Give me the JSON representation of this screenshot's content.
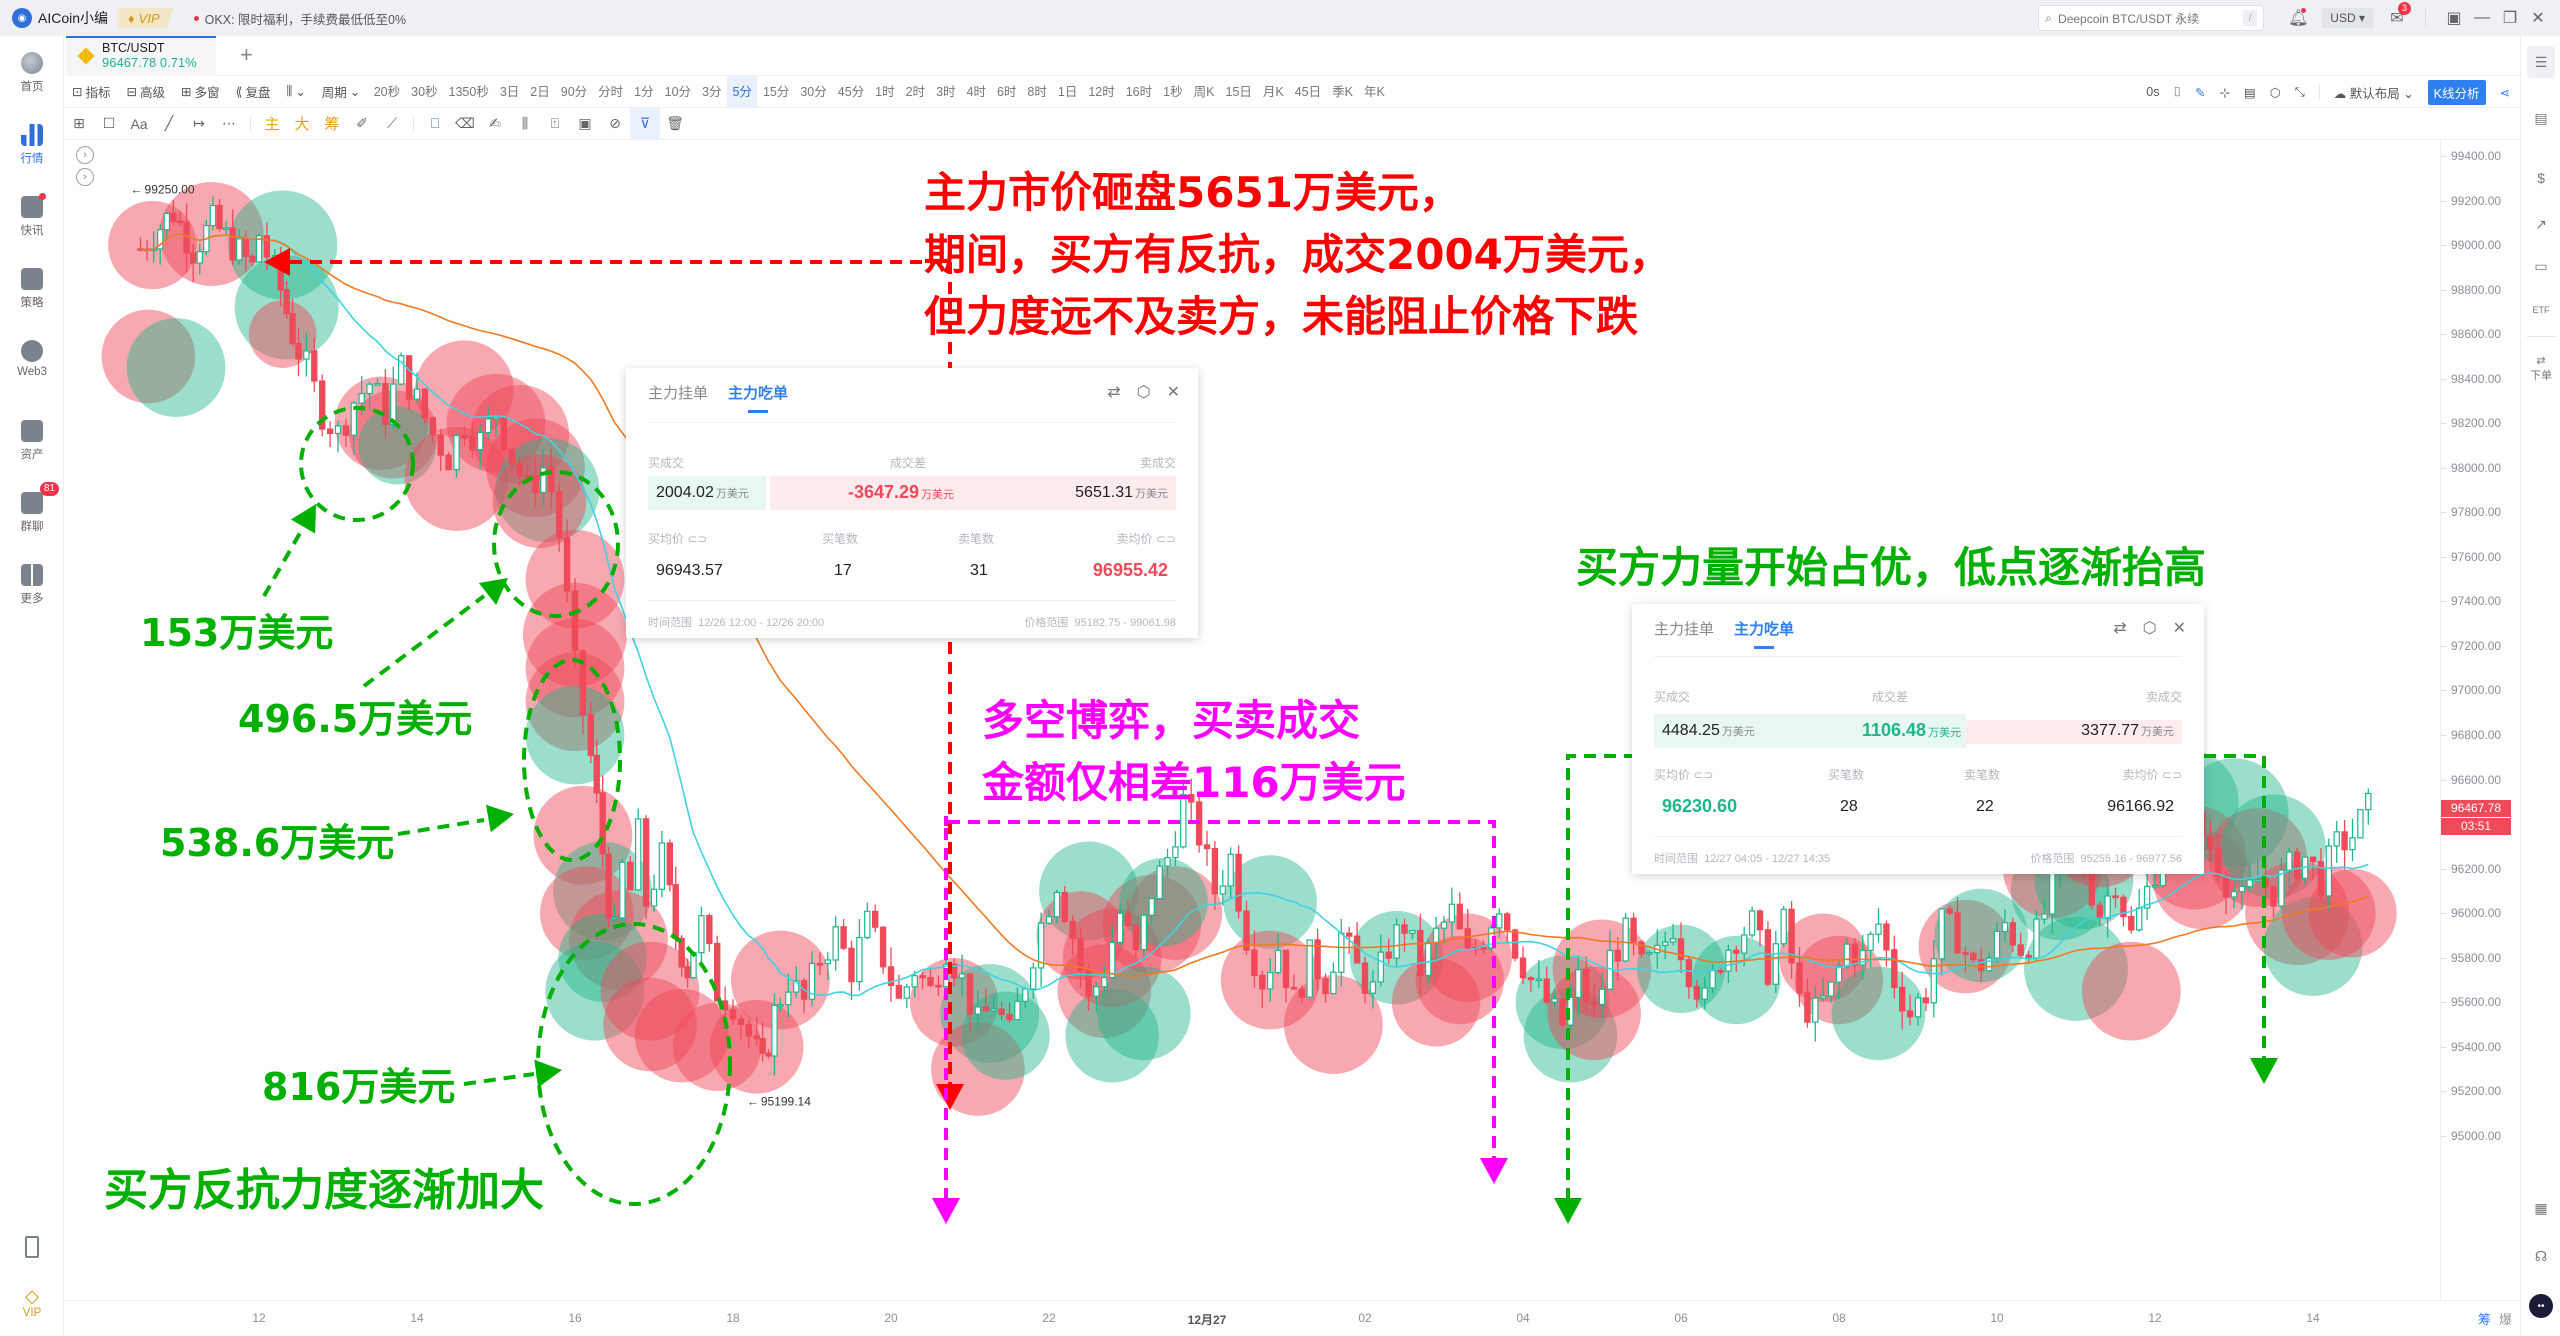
{
  "titlebar": {
    "app_name": "AICoin小编",
    "vip_label": "VIP",
    "promo": "OKX: 限时福利，手续费最低低至0%",
    "search_placeholder": "Deepcoin BTC/USDT 永续",
    "search_shortcut": "/",
    "currency": "USD",
    "mail_badge": "3"
  },
  "left_sidebar": {
    "items": [
      {
        "label": "首页",
        "icon": "home-globe-icon"
      },
      {
        "label": "行情",
        "icon": "market-bars-icon",
        "active": true
      },
      {
        "label": "快讯",
        "icon": "news-icon",
        "dot": true
      },
      {
        "label": "策略",
        "icon": "robot-strategy-icon"
      },
      {
        "label": "Web3",
        "icon": "web3-icon"
      },
      {
        "label": "资产",
        "icon": "wallet-icon"
      },
      {
        "label": "群聊",
        "icon": "chat-icon",
        "badge": "81"
      },
      {
        "label": "更多",
        "icon": "more-grid-icon"
      }
    ],
    "bottom": [
      {
        "label": "",
        "icon": "mobile-icon"
      },
      {
        "label": "VIP",
        "icon": "vip-diamond-icon"
      }
    ]
  },
  "symbol_tab": {
    "pair": "BTC/USDT",
    "price": "96467.78",
    "change": "0.71%"
  },
  "toolbar": {
    "tools": [
      "指标",
      "高级",
      "多窗",
      "复盘",
      "",
      "周期"
    ],
    "periods": [
      "20秒",
      "30秒",
      "1350秒",
      "3日",
      "2日",
      "90分",
      "分时",
      "1分",
      "10分",
      "3分",
      "5分",
      "15分",
      "30分",
      "45分",
      "1时",
      "2时",
      "3时",
      "4时",
      "6时",
      "8时",
      "1日",
      "12时",
      "16时",
      "1秒",
      "周K",
      "15日",
      "月K",
      "45日",
      "季K",
      "年K"
    ],
    "selected_period": "5分",
    "right_timer": "0s",
    "layout_label": "默认布局",
    "kline_analysis": "K线分析"
  },
  "drawing_toolbar": {
    "gold_labels": [
      "主",
      "大",
      "筹"
    ]
  },
  "chart": {
    "y_ticks": [
      99400,
      99200,
      99000,
      98800,
      98600,
      98400,
      98200,
      98000,
      97800,
      97600,
      97400,
      97200,
      97000,
      96800,
      96600,
      96400,
      96200,
      96000,
      95800,
      95600,
      95400,
      95200,
      95000
    ],
    "y_tick_labels": [
      "99400.00",
      "99200.00",
      "99000.00",
      "98800.00",
      "98600.00",
      "98400.00",
      "98200.00",
      "98000.00",
      "97800.00",
      "97600.00",
      "97400.00",
      "97200.00",
      "97000.00",
      "96800.00",
      "96600.00",
      "",
      "96200.00",
      "96000.00",
      "95800.00",
      "95600.00",
      "95400.00",
      "95200.00",
      "95000.00"
    ],
    "x_ticks": [
      {
        "h": 0,
        "label": "12"
      },
      {
        "h": 2,
        "label": "14"
      },
      {
        "h": 4,
        "label": "16"
      },
      {
        "h": 6,
        "label": "18"
      },
      {
        "h": 8,
        "label": "20"
      },
      {
        "h": 10,
        "label": "22"
      },
      {
        "h": 12,
        "label": "12月27",
        "bold": true
      },
      {
        "h": 14,
        "label": "02"
      },
      {
        "h": 16,
        "label": "04"
      },
      {
        "h": 18,
        "label": "06"
      },
      {
        "h": 20,
        "label": "08"
      },
      {
        "h": 22,
        "label": "10"
      },
      {
        "h": 24,
        "label": "12"
      },
      {
        "h": 26,
        "label": "14"
      }
    ],
    "last_price": "96467.78",
    "countdown": "03:51",
    "high_marker": "99250.00",
    "low_marker": "95199.14",
    "bottom_tools": [
      "筹",
      "爆"
    ],
    "candles_close_path": [
      [
        -1.5,
        98950
      ],
      [
        -1.25,
        99050
      ],
      [
        -1.0,
        99150
      ],
      [
        -0.75,
        98980
      ],
      [
        -0.5,
        99100
      ],
      [
        -0.25,
        99000
      ],
      [
        0,
        98900
      ],
      [
        0.1,
        99050
      ],
      [
        0.2,
        98960
      ],
      [
        0.35,
        98800
      ],
      [
        0.5,
        98600
      ],
      [
        0.7,
        98450
      ],
      [
        0.9,
        98250
      ],
      [
        1.1,
        98150
      ],
      [
        1.3,
        98300
      ],
      [
        1.5,
        98380
      ],
      [
        1.7,
        98250
      ],
      [
        1.9,
        98450
      ],
      [
        2.1,
        98300
      ],
      [
        2.3,
        98150
      ],
      [
        2.5,
        98050
      ],
      [
        2.7,
        98200
      ],
      [
        2.9,
        98120
      ],
      [
        3.1,
        98250
      ],
      [
        3.3,
        98050
      ],
      [
        3.5,
        97900
      ],
      [
        3.7,
        98000
      ],
      [
        3.8,
        97900
      ],
      [
        3.9,
        97700
      ],
      [
        4.0,
        97400
      ],
      [
        4.1,
        97100
      ],
      [
        4.2,
        96900
      ],
      [
        4.35,
        96500
      ],
      [
        4.5,
        96050
      ],
      [
        4.6,
        95900
      ],
      [
        4.7,
        96200
      ],
      [
        4.8,
        96100
      ],
      [
        4.9,
        96350
      ],
      [
        5.0,
        96050
      ],
      [
        5.2,
        96250
      ],
      [
        5.35,
        95900
      ],
      [
        5.5,
        95750
      ],
      [
        5.7,
        95950
      ],
      [
        5.9,
        95650
      ],
      [
        6.1,
        95600
      ],
      [
        6.3,
        95450
      ],
      [
        6.45,
        95300
      ],
      [
        6.6,
        95550
      ],
      [
        6.8,
        95700
      ],
      [
        7.0,
        95600
      ],
      [
        7.2,
        95800
      ],
      [
        7.4,
        95900
      ],
      [
        7.6,
        95750
      ],
      [
        7.8,
        95950
      ],
      [
        8.0,
        95800
      ],
      [
        8.2,
        95600
      ],
      [
        8.4,
        95750
      ],
      [
        8.6,
        95650
      ],
      [
        8.8,
        95850
      ],
      [
        9.0,
        95700
      ],
      [
        9.2,
        95500
      ],
      [
        9.4,
        95600
      ],
      [
        9.6,
        95450
      ],
      [
        9.8,
        95700
      ],
      [
        10.0,
        95950
      ],
      [
        10.2,
        96150
      ],
      [
        10.4,
        95900
      ],
      [
        10.6,
        95600
      ],
      [
        10.8,
        95750
      ],
      [
        11.0,
        96000
      ],
      [
        11.2,
        95800
      ],
      [
        11.4,
        96100
      ],
      [
        11.6,
        96250
      ],
      [
        11.8,
        96500
      ],
      [
        12.0,
        96350
      ],
      [
        12.2,
        96100
      ],
      [
        12.4,
        96250
      ],
      [
        12.6,
        95900
      ],
      [
        12.8,
        95700
      ],
      [
        13.0,
        95850
      ],
      [
        13.2,
        95600
      ],
      [
        13.4,
        95800
      ],
      [
        13.6,
        95700
      ],
      [
        13.8,
        95900
      ],
      [
        14.0,
        95750
      ],
      [
        14.2,
        95650
      ],
      [
        14.4,
        95850
      ],
      [
        14.6,
        95950
      ],
      [
        14.8,
        95750
      ],
      [
        15.0,
        95900
      ],
      [
        15.2,
        96000
      ],
      [
        15.4,
        95800
      ],
      [
        15.6,
        95900
      ],
      [
        15.8,
        96050
      ],
      [
        16.0,
        95850
      ],
      [
        16.2,
        95700
      ],
      [
        16.4,
        95600
      ],
      [
        16.6,
        95500
      ],
      [
        16.8,
        95700
      ],
      [
        17.0,
        95550
      ],
      [
        17.2,
        95800
      ],
      [
        17.4,
        95900
      ],
      [
        17.6,
        95750
      ],
      [
        17.8,
        95800
      ],
      [
        18.0,
        95950
      ],
      [
        18.2,
        95750
      ],
      [
        18.4,
        95600
      ],
      [
        18.6,
        95800
      ],
      [
        18.8,
        95900
      ],
      [
        19.0,
        95950
      ],
      [
        19.2,
        95750
      ],
      [
        19.4,
        95950
      ],
      [
        19.6,
        95600
      ],
      [
        19.8,
        95550
      ],
      [
        20.0,
        95650
      ],
      [
        20.2,
        95850
      ],
      [
        20.4,
        95800
      ],
      [
        20.6,
        95950
      ],
      [
        20.8,
        95700
      ],
      [
        21.0,
        95550
      ],
      [
        21.2,
        95650
      ],
      [
        21.4,
        95950
      ],
      [
        21.6,
        95900
      ],
      [
        21.8,
        95750
      ],
      [
        22.0,
        95800
      ],
      [
        22.2,
        95950
      ],
      [
        22.4,
        95850
      ],
      [
        22.6,
        95900
      ],
      [
        22.8,
        96100
      ],
      [
        23.0,
        96300
      ],
      [
        23.2,
        96200
      ],
      [
        23.4,
        96000
      ],
      [
        23.6,
        96150
      ],
      [
        23.8,
        95900
      ],
      [
        24.0,
        96100
      ],
      [
        24.2,
        96300
      ],
      [
        24.4,
        96250
      ],
      [
        24.6,
        96400
      ],
      [
        24.8,
        96300
      ],
      [
        25.0,
        96150
      ],
      [
        25.2,
        96050
      ],
      [
        25.4,
        96150
      ],
      [
        25.6,
        96100
      ],
      [
        25.8,
        96200
      ],
      [
        26.0,
        96250
      ],
      [
        26.2,
        96150
      ],
      [
        26.4,
        96300
      ],
      [
        26.6,
        96350
      ],
      [
        26.8,
        96467.78
      ]
    ],
    "bubbles": [
      {
        "h": -1.35,
        "p": 99000,
        "r": 34,
        "side": "sell"
      },
      {
        "h": -0.6,
        "p": 99050,
        "r": 40,
        "side": "sell"
      },
      {
        "h": 0.3,
        "p": 99000,
        "r": 42,
        "side": "buy"
      },
      {
        "h": 0.35,
        "p": 98720,
        "r": 40,
        "side": "buy"
      },
      {
        "h": 0.3,
        "p": 98600,
        "r": 26,
        "side": "sell"
      },
      {
        "h": -1.4,
        "p": 98500,
        "r": 36,
        "side": "sell"
      },
      {
        "h": -1.05,
        "p": 98450,
        "r": 38,
        "side": "buy"
      },
      {
        "h": 1.55,
        "p": 98200,
        "r": 36,
        "side": "sell"
      },
      {
        "h": 1.7,
        "p": 98150,
        "r": 34,
        "side": "sell"
      },
      {
        "h": 1.75,
        "p": 98100,
        "r": 30,
        "side": "buy"
      },
      {
        "h": 2.6,
        "p": 98350,
        "r": 38,
        "side": "sell"
      },
      {
        "h": 3.0,
        "p": 98200,
        "r": 38,
        "side": "sell"
      },
      {
        "h": 3.3,
        "p": 98150,
        "r": 38,
        "side": "sell"
      },
      {
        "h": 2.5,
        "p": 97950,
        "r": 40,
        "side": "sell"
      },
      {
        "h": 3.5,
        "p": 98000,
        "r": 38,
        "side": "sell"
      },
      {
        "h": 3.65,
        "p": 97900,
        "r": 40,
        "side": "buy"
      },
      {
        "h": 3.55,
        "p": 97850,
        "r": 36,
        "side": "sell"
      },
      {
        "h": 4.0,
        "p": 97500,
        "r": 38,
        "side": "sell"
      },
      {
        "h": 4.0,
        "p": 97250,
        "r": 40,
        "side": "sell"
      },
      {
        "h": 4.0,
        "p": 97100,
        "r": 38,
        "side": "sell"
      },
      {
        "h": 4.0,
        "p": 96950,
        "r": 38,
        "side": "sell"
      },
      {
        "h": 4.0,
        "p": 96800,
        "r": 38,
        "side": "buy"
      },
      {
        "h": 4.1,
        "p": 96350,
        "r": 38,
        "side": "sell"
      },
      {
        "h": 4.35,
        "p": 96100,
        "r": 38,
        "side": "buy"
      },
      {
        "h": 4.15,
        "p": 96000,
        "r": 36,
        "side": "sell"
      },
      {
        "h": 4.55,
        "p": 95880,
        "r": 38,
        "side": "sell"
      },
      {
        "h": 4.35,
        "p": 95800,
        "r": 34,
        "side": "buy"
      },
      {
        "h": 4.25,
        "p": 95650,
        "r": 38,
        "side": "buy"
      },
      {
        "h": 4.95,
        "p": 95650,
        "r": 38,
        "side": "sell"
      },
      {
        "h": 4.95,
        "p": 95500,
        "r": 36,
        "side": "sell"
      },
      {
        "h": 5.35,
        "p": 95450,
        "r": 36,
        "side": "sell"
      },
      {
        "h": 5.8,
        "p": 95400,
        "r": 34,
        "side": "sell"
      },
      {
        "h": 6.6,
        "p": 95700,
        "r": 38,
        "side": "sell"
      },
      {
        "h": 6.3,
        "p": 95400,
        "r": 36,
        "side": "sell"
      },
      {
        "h": 8.8,
        "p": 95600,
        "r": 34,
        "side": "sell"
      },
      {
        "h": 9.25,
        "p": 95550,
        "r": 38,
        "side": "buy"
      },
      {
        "h": 9.1,
        "p": 95300,
        "r": 36,
        "side": "sell"
      },
      {
        "h": 9.45,
        "p": 95450,
        "r": 34,
        "side": "buy"
      },
      {
        "h": 10.5,
        "p": 96100,
        "r": 38,
        "side": "buy"
      },
      {
        "h": 10.4,
        "p": 95900,
        "r": 34,
        "side": "sell"
      },
      {
        "h": 10.7,
        "p": 95650,
        "r": 36,
        "side": "sell"
      },
      {
        "h": 10.8,
        "p": 95450,
        "r": 36,
        "side": "buy"
      },
      {
        "h": 10.8,
        "p": 95800,
        "r": 38,
        "side": "sell"
      },
      {
        "h": 11.3,
        "p": 95950,
        "r": 38,
        "side": "sell"
      },
      {
        "h": 11.6,
        "p": 96000,
        "r": 36,
        "side": "sell"
      },
      {
        "h": 11.2,
        "p": 95550,
        "r": 36,
        "side": "buy"
      },
      {
        "h": 11.45,
        "p": 96050,
        "r": 34,
        "side": "buy"
      },
      {
        "h": 12.8,
        "p": 96050,
        "r": 36,
        "side": "buy"
      },
      {
        "h": 12.8,
        "p": 95700,
        "r": 38,
        "side": "sell"
      },
      {
        "h": 13.6,
        "p": 95500,
        "r": 38,
        "side": "sell"
      },
      {
        "h": 14.4,
        "p": 95800,
        "r": 36,
        "side": "buy"
      },
      {
        "h": 14.9,
        "p": 95600,
        "r": 34,
        "side": "sell"
      },
      {
        "h": 15.2,
        "p": 95700,
        "r": 34,
        "side": "sell"
      },
      {
        "h": 15.3,
        "p": 95800,
        "r": 34,
        "side": "sell"
      },
      {
        "h": 16.5,
        "p": 95600,
        "r": 36,
        "side": "buy"
      },
      {
        "h": 16.6,
        "p": 95450,
        "r": 36,
        "side": "buy"
      },
      {
        "h": 17.0,
        "p": 95750,
        "r": 38,
        "side": "sell"
      },
      {
        "h": 16.9,
        "p": 95550,
        "r": 36,
        "side": "sell"
      },
      {
        "h": 18.0,
        "p": 95750,
        "r": 34,
        "side": "buy"
      },
      {
        "h": 18.7,
        "p": 95700,
        "r": 34,
        "side": "buy"
      },
      {
        "h": 19.8,
        "p": 95800,
        "r": 34,
        "side": "sell"
      },
      {
        "h": 20.0,
        "p": 95700,
        "r": 34,
        "side": "sell"
      },
      {
        "h": 20.5,
        "p": 95550,
        "r": 36,
        "side": "buy"
      },
      {
        "h": 21.6,
        "p": 95850,
        "r": 36,
        "side": "sell"
      },
      {
        "h": 21.8,
        "p": 95900,
        "r": 36,
        "side": "buy"
      },
      {
        "h": 22.8,
        "p": 96100,
        "r": 38,
        "side": "buy"
      },
      {
        "h": 22.7,
        "p": 96200,
        "r": 38,
        "side": "sell"
      },
      {
        "h": 23.1,
        "p": 96150,
        "r": 38,
        "side": "buy"
      },
      {
        "h": 23.3,
        "p": 96350,
        "r": 40,
        "side": "sell"
      },
      {
        "h": 23.0,
        "p": 95750,
        "r": 40,
        "side": "buy"
      },
      {
        "h": 23.7,
        "p": 95650,
        "r": 38,
        "side": "sell"
      },
      {
        "h": 24.4,
        "p": 96500,
        "r": 40,
        "side": "buy"
      },
      {
        "h": 24.5,
        "p": 96250,
        "r": 40,
        "side": "sell"
      },
      {
        "h": 24.6,
        "p": 96150,
        "r": 38,
        "side": "sell"
      },
      {
        "h": 25.0,
        "p": 96450,
        "r": 42,
        "side": "buy"
      },
      {
        "h": 25.3,
        "p": 96250,
        "r": 38,
        "side": "sell"
      },
      {
        "h": 25.5,
        "p": 96300,
        "r": 40,
        "side": "buy"
      },
      {
        "h": 25.8,
        "p": 96000,
        "r": 40,
        "side": "sell"
      },
      {
        "h": 26.0,
        "p": 95850,
        "r": 38,
        "side": "buy"
      },
      {
        "h": 26.2,
        "p": 96000,
        "r": 36,
        "side": "sell"
      },
      {
        "h": 26.5,
        "p": 96000,
        "r": 34,
        "side": "sell"
      }
    ]
  },
  "panel1": {
    "tab_inactive": "主力挂单",
    "tab_active": "主力吃单",
    "buy_label": "买成交",
    "diff_label": "成交差",
    "sell_label": "卖成交",
    "buy_value": "2004.02",
    "diff_value": "-3647.29",
    "sell_value": "5651.31",
    "unit": "万美元",
    "avg_buy_label": "买均价",
    "buy_count_label": "买笔数",
    "sell_count_label": "卖笔数",
    "avg_sell_label": "卖均价",
    "avg_buy": "96943.57",
    "buy_count": "17",
    "sell_count": "31",
    "avg_sell": "96955.42",
    "time_label": "时间范围",
    "time_range": "12/26 12:00 - 12/26 20:00",
    "price_label": "价格范围",
    "price_range": "95182.75 - 99061.98"
  },
  "panel2": {
    "tab_inactive": "主力挂单",
    "tab_active": "主力吃单",
    "buy_label": "买成交",
    "diff_label": "成交差",
    "sell_label": "卖成交",
    "buy_value": "4484.25",
    "diff_value": "1106.48",
    "sell_value": "3377.77",
    "unit": "万美元",
    "avg_buy_label": "买均价",
    "buy_count_label": "买笔数",
    "sell_count_label": "卖笔数",
    "avg_sell_label": "卖均价",
    "avg_buy": "96230.60",
    "buy_count": "28",
    "sell_count": "22",
    "avg_sell": "96166.92",
    "time_label": "时间范围",
    "time_range": "12/27 04:05 - 12/27 14:35",
    "price_label": "价格范围",
    "price_range": "95255.16 - 96977.56"
  },
  "annotations": {
    "red_line1": "主力市价砸盘5651万美元，",
    "red_line2": "期间，买方有反抗，成交2004万美元，",
    "red_line3": "但力度远不及卖方，未能阻止价格下跌",
    "magenta_line1": "多空博弈，买卖成交",
    "magenta_line2": "金额仅相差116万美元",
    "green_top": "买方力量开始占优，低点逐渐抬高",
    "g153": "153万美元",
    "g496": "496.5万美元",
    "g538": "538.6万美元",
    "g816": "816万美元",
    "green_bottom": "买方反抗力度逐渐加大",
    "colors": {
      "red": "#ff0000",
      "magenta": "#ff00ff",
      "green": "#00b000"
    }
  },
  "colors": {
    "up": "#21b58b",
    "down": "#ef4a5a",
    "ma_fast": "#3fd3e0",
    "ma_slow": "#f07a22",
    "accent": "#2f7ff0"
  }
}
